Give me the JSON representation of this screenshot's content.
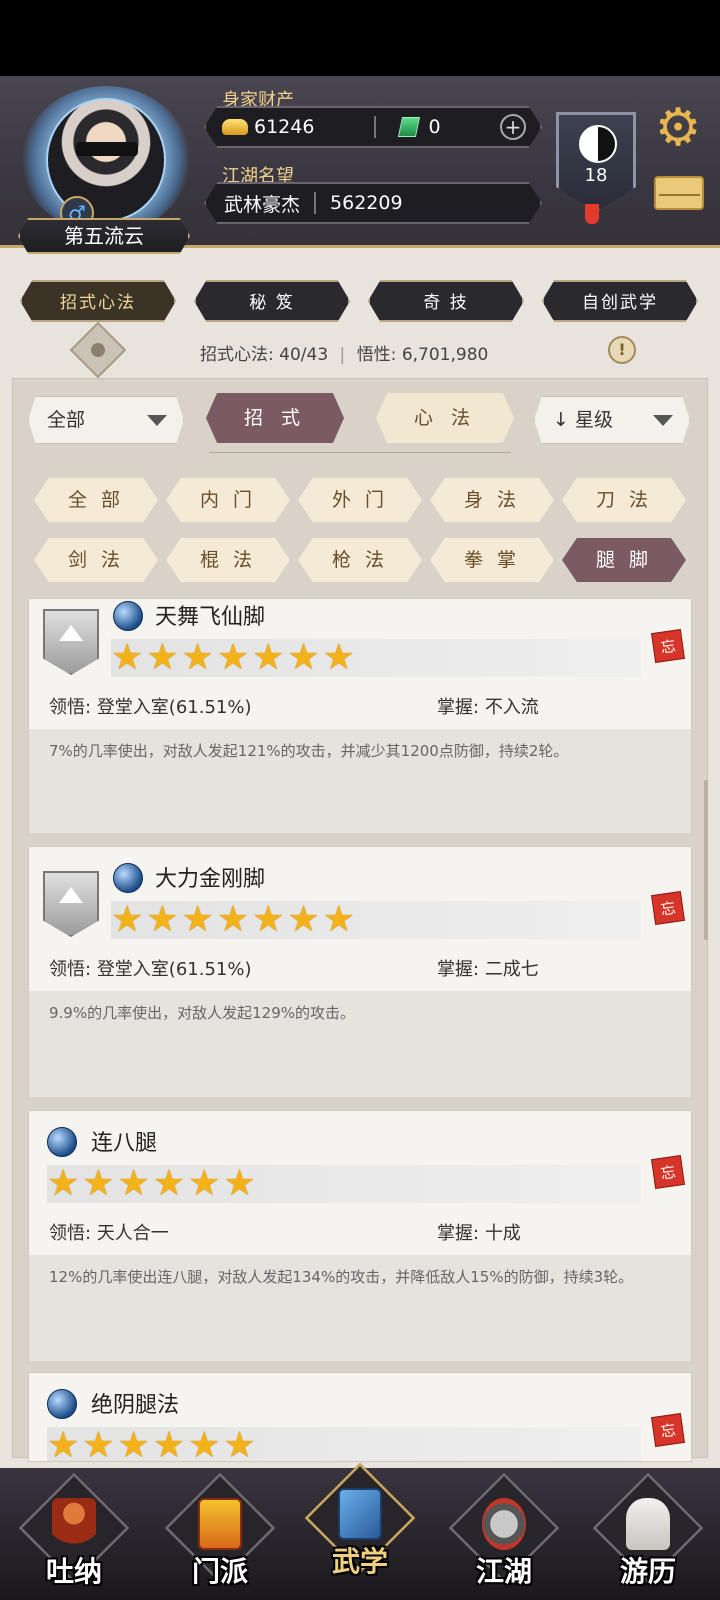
{
  "header": {
    "player_name": "第五流云",
    "wealth_label": "身家财产",
    "gold": "61246",
    "jade": "0",
    "reputation_label": "江湖名望",
    "reputation_title": "武林豪杰",
    "reputation_value": "562209",
    "level": "18"
  },
  "tabs": [
    "招式心法",
    "秘 笈",
    "奇 技",
    "自创武学"
  ],
  "stats": {
    "count_label": "招式心法:",
    "count_value": "40/43",
    "insight_label": "悟性:",
    "insight_value": "6,701,980"
  },
  "filters": {
    "category": "全部",
    "seg_active": "招 式",
    "seg_other": "心 法",
    "sort": "星级",
    "sort_arrow": "↓"
  },
  "chips": [
    [
      "全 部",
      "内 门",
      "外 门",
      "身 法",
      "刀 法"
    ],
    [
      "剑 法",
      "棍 法",
      "枪 法",
      "拳 掌",
      "腿 脚"
    ]
  ],
  "active_chip": "腿 脚",
  "skills": [
    {
      "name": "天舞飞仙脚",
      "stars": "★★★★★★★",
      "comprehension_label": "领悟:",
      "comprehension": "登堂入室(61.51%)",
      "mastery_label": "掌握:",
      "mastery": "不入流",
      "desc": "7%的几率使出，对敌人发起121%的攻击，并减少其1200点防御，持续2轮。",
      "forget": "忘"
    },
    {
      "name": "大力金刚脚",
      "stars": "★★★★★★★",
      "comprehension_label": "领悟:",
      "comprehension": "登堂入室(61.51%)",
      "mastery_label": "掌握:",
      "mastery": "二成七",
      "desc": "9.9%的几率使出，对敌人发起129%的攻击。",
      "forget": "忘"
    },
    {
      "name": "连八腿",
      "stars": "★★★★★★",
      "comprehension_label": "领悟:",
      "comprehension": "天人合一",
      "mastery_label": "掌握:",
      "mastery": "十成",
      "desc": "12%的几率使出连八腿，对敌人发起134%的攻击，并降低敌人15%的防御，持续3轮。",
      "forget": "忘"
    },
    {
      "name": "绝阴腿法",
      "stars": "★★★★★★",
      "forget": "忘"
    }
  ],
  "bottom_nav": [
    "吐纳",
    "门派",
    "武学",
    "江湖",
    "游历"
  ],
  "bottom_nav_active": "武学"
}
